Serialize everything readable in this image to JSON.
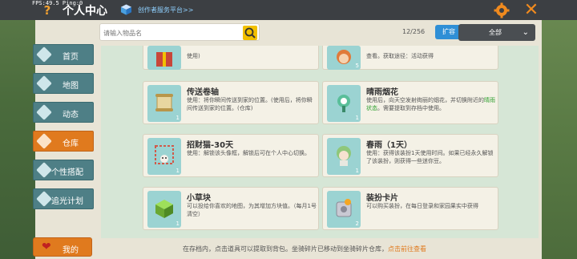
{
  "topbar": {
    "fps_text": "FPS:49.5  Ping:0",
    "title": "个人中心",
    "creator_link": "创作者服务平台>>",
    "help_glyph": "?",
    "close_glyph": "✕"
  },
  "search": {
    "placeholder": "请输入物品名",
    "count": "12/256",
    "expand_label": "扩容",
    "filter_value": "全部"
  },
  "sidebar": {
    "items": [
      {
        "label": "首页",
        "icon": "home-icon",
        "active": false
      },
      {
        "label": "地图",
        "icon": "map-icon",
        "active": false
      },
      {
        "label": "动态",
        "icon": "feed-icon",
        "active": false
      },
      {
        "label": "仓库",
        "icon": "warehouse-icon",
        "active": true
      },
      {
        "label": "个性搭配",
        "icon": "outfit-icon",
        "active": false
      },
      {
        "label": "追光计划",
        "icon": "light-icon",
        "active": false
      }
    ],
    "mine_label": "我的"
  },
  "items": [
    {
      "name": "",
      "desc": "使用)",
      "count": "",
      "color": "#c8463a"
    },
    {
      "name": "",
      "desc": "查看。获取途径：活动获得",
      "count": "5",
      "color": "#e07a3a"
    },
    {
      "name": "传送卷轴",
      "desc": "使用：将你瞬间传送到家的位置。(使用后，将你瞬间传送到家的位置。(仓库)",
      "count": "1",
      "color": "#d9c07a"
    },
    {
      "name": "晴雨烟花",
      "desc_pre": "使用后，向天空发射绚丽的烟花，并切换附近的",
      "desc_hl": "晴雨状态",
      "desc_post": "。需要提取到存档中使用。",
      "count": "1",
      "color": "#5abf9a"
    },
    {
      "name": "招财猫-30天",
      "desc": "使用：解锁该头像框，解锁后可在个人中心切换。",
      "count": "1",
      "color": "#e9b9a2"
    },
    {
      "name": "春雨（1天）",
      "desc": "使用：获得该装扮1天使用时间。如果已经永久解锁了该装扮，则获得一些迷你豆。",
      "count": "1",
      "color": "#8fc77a"
    },
    {
      "name": "小草块",
      "desc": "可以投给你喜欢的地图，为其增加方块值。（每月1号清空）",
      "count": "1",
      "color": "#7bc346"
    },
    {
      "name": "装扮卡片",
      "desc": "可以购买装扮，在每日登录和家园果实中获得",
      "count": "2",
      "color": "#b9b9c3"
    }
  ],
  "footer": {
    "text": "在存档内，点击道具可以提取到背包。坐骑碎片已移动到坐骑碎片仓库，",
    "link": "点击前往查看"
  }
}
